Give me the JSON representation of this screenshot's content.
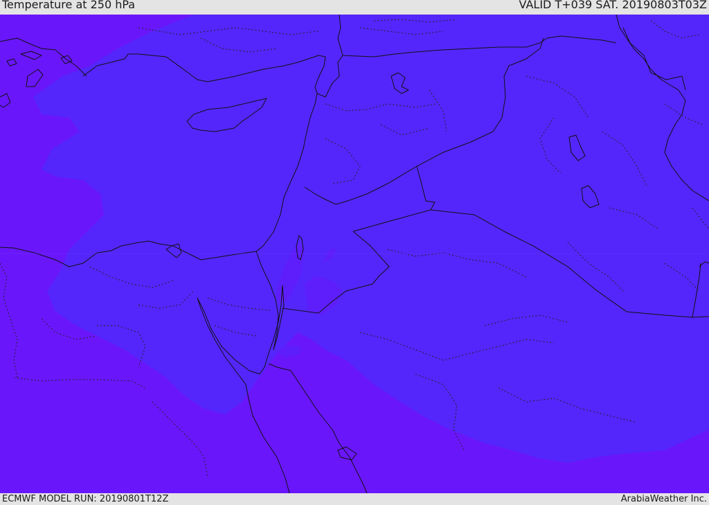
{
  "header": {
    "title": "Temperature at 250 hPa",
    "valid_time": "VALID T+039 SAT. 20190803T03Z"
  },
  "footer": {
    "model_run": "ECMWF MODEL RUN: 20190801T12Z",
    "credit": "ArabiaWeather Inc."
  },
  "colors": {
    "cold_field": "#6a16fb",
    "warm_field": "#5426fb",
    "lines": "#111111",
    "chrome": "#e4e4e4"
  }
}
